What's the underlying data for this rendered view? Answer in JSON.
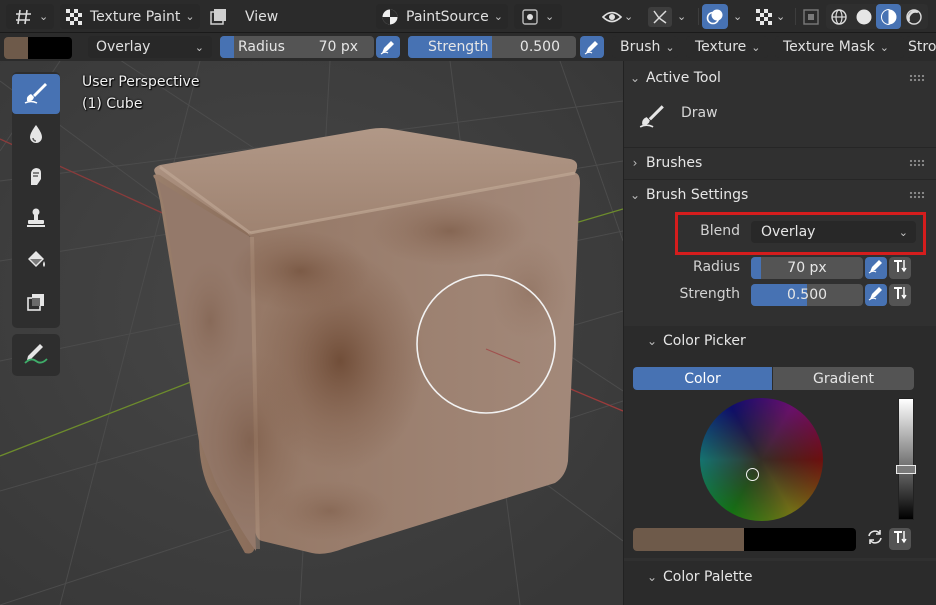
{
  "header": {
    "mode": "Texture Paint",
    "view_menu": "View",
    "paint_source": "PaintSource"
  },
  "tool_settings": {
    "blend": "Overlay",
    "radius_label": "Radius",
    "radius_value": "70 px",
    "radius_fraction": 0.09,
    "strength_label": "Strength",
    "strength_value": "0.500",
    "strength_fraction": 0.5,
    "menus": [
      "Brush",
      "Texture",
      "Texture Mask",
      "Stro"
    ],
    "primary_color": "#6e5a4a",
    "secondary_color": "#000000"
  },
  "viewport": {
    "perspective": "User Perspective",
    "object": "(1) Cube"
  },
  "sidebar": {
    "active_tool_header": "Active Tool",
    "active_tool_name": "Draw",
    "brushes_header": "Brushes",
    "brush_settings_header": "Brush Settings",
    "blend_label": "Blend",
    "blend_value": "Overlay",
    "radius_label": "Radius",
    "radius_value": "70 px",
    "strength_label": "Strength",
    "strength_value": "0.500",
    "color_picker_header": "Color Picker",
    "color_tab": "Color",
    "gradient_tab": "Gradient",
    "color_palette_header": "Color Palette"
  },
  "colors": {
    "accent": "#4772b3",
    "highlight_box": "#d51d1d",
    "brush_color": "#6e5a4a"
  }
}
